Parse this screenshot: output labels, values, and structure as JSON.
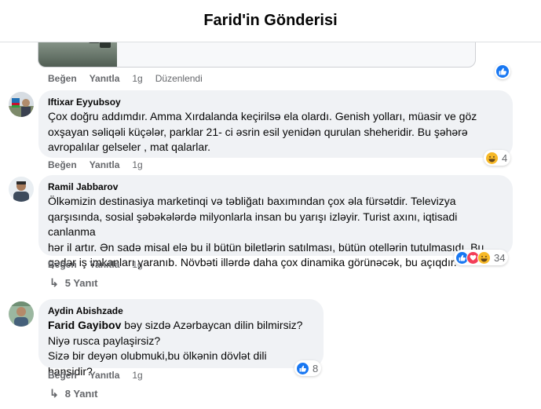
{
  "header": {
    "title": "Farid'in Gönderisi"
  },
  "top_comment": {
    "actions": {
      "like": "Beğen",
      "reply": "Yanıtla",
      "time": "1g",
      "edited": "Düzenlendi"
    }
  },
  "comments": [
    {
      "author": "Iftixar Eyyubsoy",
      "lines": [
        "Çox doğru addımdır. Amma Xırdalanda keçirilsə ela olardı. Genish yolları, müasir ve göz",
        "oxşayan səliqəli küçələr, parklar 21- ci əsrin esil yenidən qurulan sheheridir. Bu şəhərə",
        "avropalılar gelseler , mat qalarlar."
      ],
      "actions": {
        "like": "Beğen",
        "reply": "Yanıtla",
        "time": "1g"
      },
      "reaction_count": "4"
    },
    {
      "author": "Ramil Jabbarov",
      "lines": [
        "Ölkəmizin destinasiya marketinqi və təbliğatı baxımından çox əla fürsətdir. Televizya",
        "qarşısında, sosial şəbəkələrdə milyonlarla insan bu yarışı izləyir. Turist axını, iqtisadi canlanma",
        "hər il artır. Ən sadə misal elə bu il bütün biletlərin satılması, bütün otellərin tutulmasıdı. Bu",
        "qədər iş imkanları yaranıb. Növbəti illərdə daha çox dinamika görünəcək, bu açıqdır."
      ],
      "actions": {
        "like": "Beğen",
        "reply": "Yanıtla",
        "time": "1g"
      },
      "reaction_count": "34",
      "replies": "5 Yanıt"
    },
    {
      "author": "Aydin Abishzade",
      "mention": "Farid Gayibov",
      "lines": [
        " bəy sizdə Azərbaycan dilin bilmirsiz?",
        "Niyə rusca paylaşirsiz?",
        "Sizə bir deyən olubmuki,bu ölkənin dövlət dili hansidir?"
      ],
      "actions": {
        "like": "Beğen",
        "reply": "Yanıtla",
        "time": "1g"
      },
      "reaction_count": "8",
      "replies": "8 Yanıt"
    }
  ],
  "colors": {
    "like": "#1877f2",
    "love": "#f33e58",
    "haha": "#f7b928",
    "bubble": "#f0f2f5",
    "secondary_text": "#65676b"
  },
  "icons": [
    "like-icon",
    "love-icon",
    "haha-icon",
    "reply-arrow-icon"
  ]
}
